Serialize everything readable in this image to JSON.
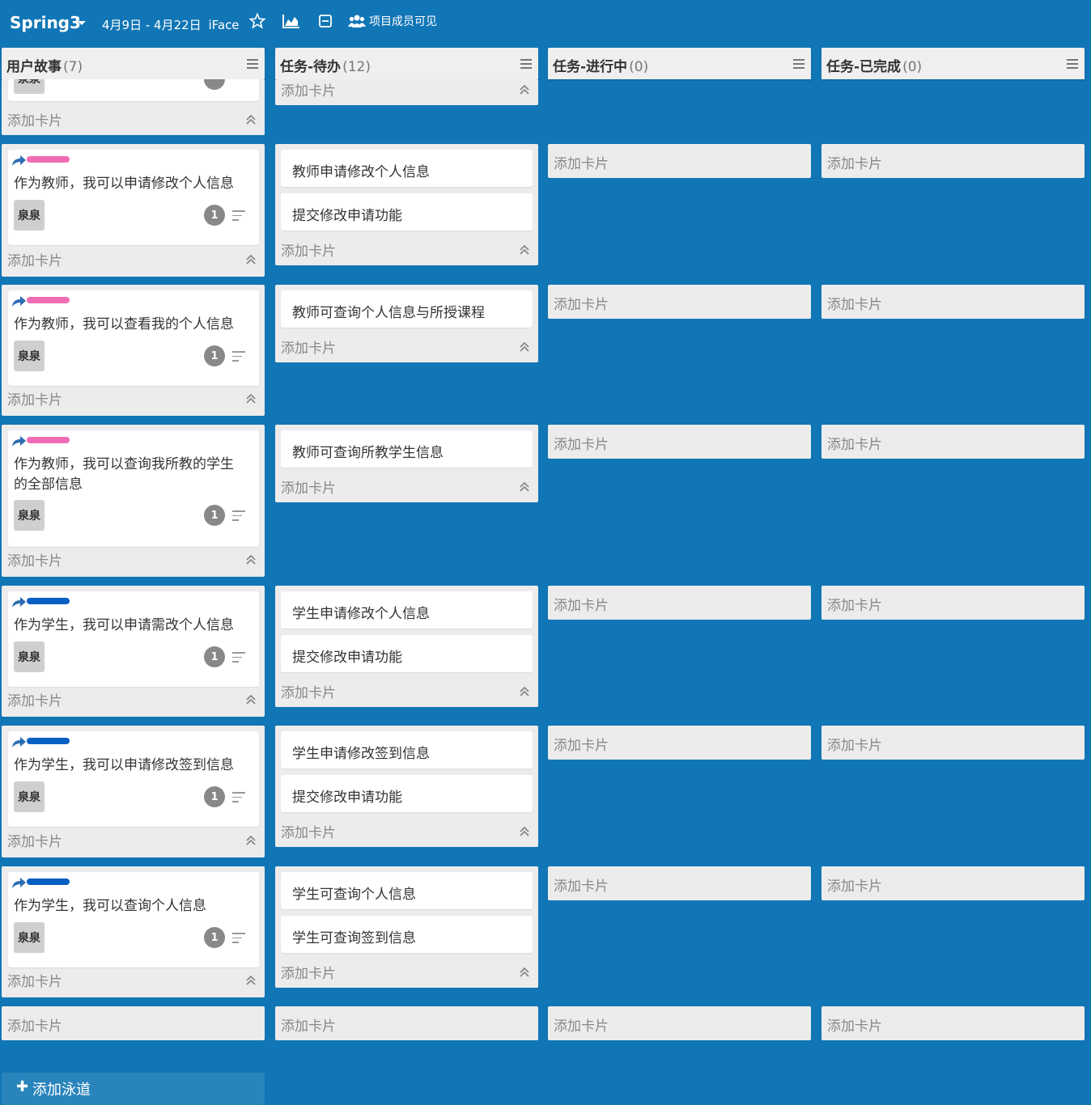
{
  "top": {
    "sprint": "Spring3",
    "dates": "4月9日 - 4月22日",
    "project": "iFace",
    "visibility": "项目成员可见",
    "icons": [
      "star-icon",
      "chart-icon",
      "collapse-view-icon",
      "group-icon"
    ]
  },
  "columns": [
    {
      "title": "用户故事",
      "count": "(7)"
    },
    {
      "title": "任务-待办",
      "count": "(12)"
    },
    {
      "title": "任务-进行中",
      "count": "(0)"
    },
    {
      "title": "任务-已完成",
      "count": "(0)"
    }
  ],
  "add_card": "添加卡片",
  "add_lane": "添加泳道",
  "first_row": {
    "avatar": "泉泉"
  },
  "stories": [
    {
      "line1": "作为教师，我可以申请修改个人信息",
      "line2": "",
      "label_color": "#f06db4",
      "avatar": "泉泉",
      "count": "1",
      "tasks": [
        "教师申请修改个人信息",
        "提交修改申请功能"
      ]
    },
    {
      "line1": "作为教师，我可以查看我的个人信息",
      "line2": "",
      "label_color": "#f06db4",
      "avatar": "泉泉",
      "count": "1",
      "tasks": [
        "教师可查询个人信息与所授课程"
      ]
    },
    {
      "line1": "作为教师，我可以查询我所教的学生",
      "line2": "的全部信息",
      "label_color": "#f06db4",
      "avatar": "泉泉",
      "count": "1",
      "tasks": [
        "教师可查询所教学生信息"
      ]
    },
    {
      "line1": "作为学生，我可以申请需改个人信息",
      "line2": "",
      "label_color": "#0a5fc2",
      "avatar": "泉泉",
      "count": "1",
      "tasks": [
        "学生申请修改个人信息",
        "提交修改申请功能"
      ]
    },
    {
      "line1": "作为学生，我可以申请修改签到信息",
      "line2": "",
      "label_color": "#0a5fc2",
      "avatar": "泉泉",
      "count": "1",
      "tasks": [
        "学生申请修改签到信息",
        "提交修改申请功能"
      ]
    },
    {
      "line1": "作为学生，我可以查询个人信息",
      "line2": "",
      "label_color": "#0a5fc2",
      "avatar": "泉泉",
      "count": "1",
      "tasks": [
        "学生可查询个人信息",
        "学生可查询签到信息"
      ]
    }
  ]
}
